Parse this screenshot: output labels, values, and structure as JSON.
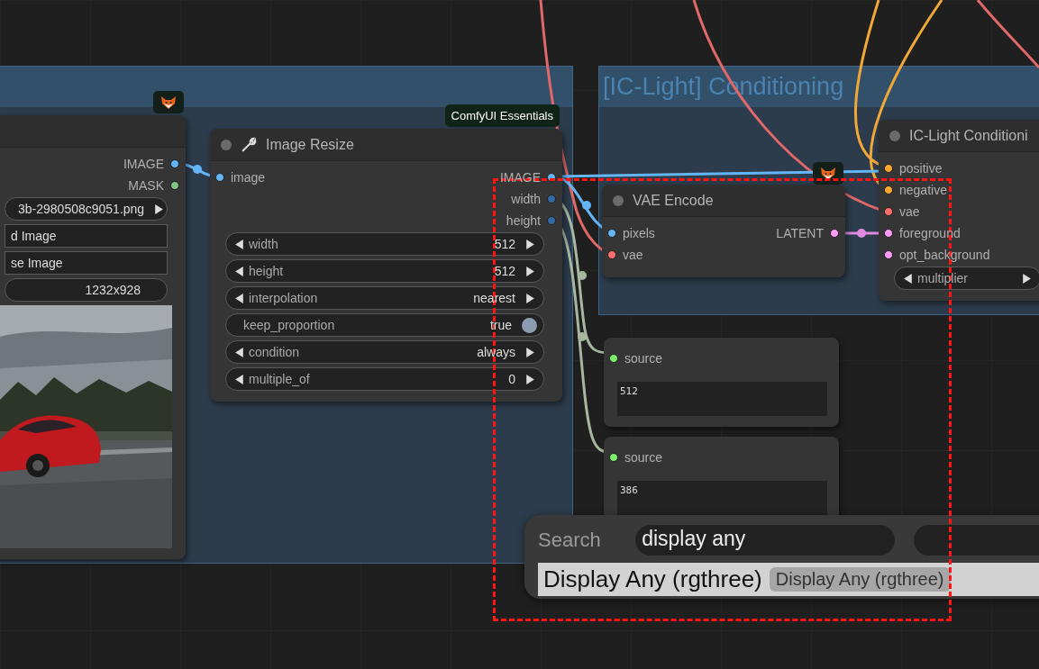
{
  "groups": [
    {
      "title": "[IC-Light] Conditioning"
    }
  ],
  "nodes": [
    {
      "outputs": [
        {
          "label": "IMAGE",
          "color": "#64b5f6"
        },
        {
          "label": "MASK",
          "color": "#81c784"
        }
      ],
      "widgets": [
        {
          "kind": "combo",
          "value": "3b-2980508c9051.png"
        },
        {
          "kind": "button",
          "label": "d Image"
        },
        {
          "kind": "button",
          "label": "se Image"
        },
        {
          "kind": "readout",
          "value": "1232x928"
        }
      ],
      "preview": {
        "kind": "picture"
      }
    },
    {
      "title": "Image Resize",
      "badge": "ComfyUI Essentials",
      "inputs": [
        {
          "label": "image",
          "color": "#64b5f6"
        }
      ],
      "outputs": [
        {
          "label": "IMAGE",
          "color": "#64b5f6"
        },
        {
          "label": "width",
          "color": "#2f6aa3"
        },
        {
          "label": "height",
          "color": "#2f6aa3"
        }
      ],
      "widgets": [
        {
          "kind": "combo",
          "label": "width",
          "value": "512"
        },
        {
          "kind": "combo",
          "label": "height",
          "value": "512"
        },
        {
          "kind": "combo",
          "label": "interpolation",
          "value": "nearest"
        },
        {
          "kind": "toggle",
          "label": "keep_proportion",
          "value": "true",
          "on": true
        },
        {
          "kind": "combo",
          "label": "condition",
          "value": "always"
        },
        {
          "kind": "combo",
          "label": "multiple_of",
          "value": "0"
        }
      ]
    },
    {
      "title": "VAE Encode",
      "inputs": [
        {
          "label": "pixels",
          "color": "#64b5f6"
        },
        {
          "label": "vae",
          "color": "#ff6e6e"
        }
      ],
      "outputs": [
        {
          "label": "LATENT",
          "color": "#ff9cf9"
        }
      ]
    },
    {
      "title": "IC-Light Conditioni",
      "inputs": [
        {
          "label": "positive",
          "color": "#ffa931"
        },
        {
          "label": "negative",
          "color": "#ffa931"
        },
        {
          "label": "vae",
          "color": "#ff6e6e"
        },
        {
          "label": "foreground",
          "color": "#ff9cf9"
        },
        {
          "label": "opt_background",
          "color": "#ff9cf9"
        }
      ],
      "widgets": [
        {
          "kind": "combo",
          "label": "multiplier"
        }
      ]
    },
    {
      "inputs": [
        {
          "label": "source",
          "color": "#7cf06a"
        }
      ],
      "widgets": [
        {
          "kind": "text",
          "value": "512"
        }
      ]
    },
    {
      "inputs": [
        {
          "label": "source",
          "color": "#7cf06a"
        }
      ],
      "widgets": [
        {
          "kind": "text",
          "value": "386"
        }
      ]
    }
  ],
  "search": {
    "label": "Search",
    "query": "display any",
    "results": [
      {
        "name": "Display Any (rgthree)",
        "tag": "Display Any (rgthree)",
        "selected": true
      }
    ]
  }
}
